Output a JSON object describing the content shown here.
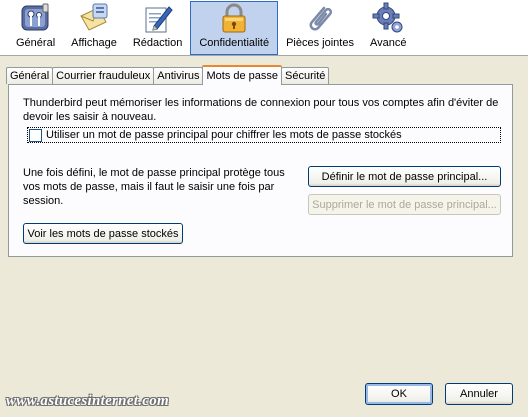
{
  "toolbar": {
    "items": [
      {
        "label": "Général",
        "icon": "general-icon"
      },
      {
        "label": "Affichage",
        "icon": "display-icon"
      },
      {
        "label": "Rédaction",
        "icon": "composition-icon"
      },
      {
        "label": "Confidentialité",
        "icon": "padlock-icon",
        "active": true
      },
      {
        "label": "Pièces jointes",
        "icon": "paperclip-icon"
      },
      {
        "label": "Avancé",
        "icon": "gear-icon"
      }
    ]
  },
  "tabs": [
    {
      "label": "Général"
    },
    {
      "label": "Courrier frauduleux"
    },
    {
      "label": "Antivirus"
    },
    {
      "label": "Mots de passe",
      "active": true
    },
    {
      "label": "Sécurité"
    }
  ],
  "panel": {
    "intro": "Thunderbird peut mémoriser les informations de connexion pour tous vos comptes afin d'éviter de devoir les saisir à nouveau.",
    "checkbox_label": "Utiliser un mot de passe principal pour chiffrer les mots de passe stockés",
    "checkbox_checked": false,
    "description": "Une fois défini, le mot de passe principal protège tous vos mots de passe, mais il faut le saisir une fois par session.",
    "define_button": "Définir le mot de passe principal...",
    "remove_button": "Supprimer le mot de passe principal...",
    "view_button": "Voir les mots de passe stockés"
  },
  "footer": {
    "ok": "OK",
    "cancel": "Annuler",
    "watermark": "www.astucesinternet.com"
  },
  "colors": {
    "accent": "#316ac5",
    "active_tab_border": "#e68b2c",
    "window_bg": "#ece9d8"
  }
}
